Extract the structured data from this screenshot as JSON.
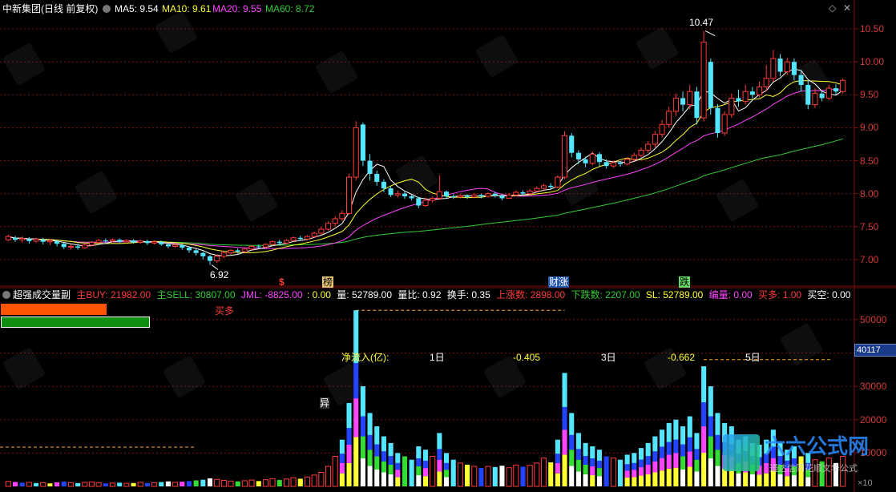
{
  "colors": {
    "bg": "#000000",
    "up": "#ff3b3b",
    "down": "#55e6ff",
    "grid": "#7a1010",
    "ma5": "#ffffff",
    "ma10": "#ffff33",
    "ma20": "#ff44ff",
    "ma60": "#33cc33",
    "green": "#00c000",
    "orange": "#ff5500"
  },
  "main_header": {
    "title": "中新集团(日线 前复权)",
    "ma5_label": "MA5: 9.54",
    "ma10_label": "MA10: 9.61",
    "ma20_label": "MA20: 9.55",
    "ma60_label": "MA60: 8.72",
    "collapse_icon": "diamond-icon",
    "close_icon": "close-icon"
  },
  "price_axis": {
    "ticks": [
      "10.50",
      "10.00",
      "9.50",
      "9.00",
      "8.50",
      "8.00",
      "7.50",
      "7.00"
    ],
    "ymin": 6.78,
    "ymax": 10.72
  },
  "annotations": {
    "high": "10.47",
    "low": "6.92",
    "event_s": "$",
    "event_1": "榜",
    "event_2": "财涨",
    "event_3": "跌"
  },
  "sub_header": {
    "title": "超强成交量副",
    "buy": "主BUY: 21982.00",
    "sell": "主SELL: 30807.00",
    "jml": "JML: -8825.00",
    "colon_val": ": 0.00",
    "vol": "量: 52789.00",
    "vol_ratio": "量比: 0.92",
    "turnover": "换手: 0.35",
    "up_count": "上涨数: 2898.00",
    "down_count": "下跌数: 2207.00",
    "sl": "SL: 52789.00",
    "bian_liang": "编量: 0.00",
    "buy_many": "买多: 1.00",
    "buy_empty": "买空: 0.00"
  },
  "sub_panel": {
    "mai_duo": "买多",
    "net_inflow_label": "净流入(亿):",
    "d1_label": "1日",
    "d1_value": "-0.405",
    "d3_label": "3日",
    "d3_value": "-0.662",
    "d5_label": "5日",
    "yi_label": "异",
    "cursor_value": "40117"
  },
  "volume_axis": {
    "ticks": [
      "50000",
      "40000",
      "30000",
      "20000",
      "10000"
    ],
    "vmax": 55000
  },
  "watermark": {
    "brand": "六六公式网",
    "subtitle": "通达信同花顺文华公式",
    "corner_text": "×10"
  },
  "chart_data": {
    "type": "candlestick",
    "series": [
      {
        "name": "MA5",
        "value": 9.54
      },
      {
        "name": "MA10",
        "value": 9.61
      },
      {
        "name": "MA20",
        "value": 9.55
      },
      {
        "name": "MA60",
        "value": 8.72
      }
    ],
    "high_label": 10.47,
    "low_label": 6.92,
    "candles": [
      [
        7.3,
        7.35,
        7.28,
        7.38
      ],
      [
        7.33,
        7.3,
        7.27,
        7.36
      ],
      [
        7.3,
        7.32,
        7.26,
        7.35
      ],
      [
        7.31,
        7.28,
        7.24,
        7.34
      ],
      [
        7.28,
        7.31,
        7.25,
        7.33
      ],
      [
        7.3,
        7.27,
        7.23,
        7.33
      ],
      [
        7.27,
        7.29,
        7.22,
        7.31
      ],
      [
        7.28,
        7.24,
        7.2,
        7.3
      ],
      [
        7.24,
        7.19,
        7.16,
        7.26
      ],
      [
        7.19,
        7.2,
        7.15,
        7.23
      ],
      [
        7.2,
        7.18,
        7.15,
        7.24
      ],
      [
        7.18,
        7.22,
        7.16,
        7.25
      ],
      [
        7.22,
        7.26,
        7.2,
        7.28
      ],
      [
        7.26,
        7.29,
        7.24,
        7.31
      ],
      [
        7.29,
        7.28,
        7.25,
        7.32
      ],
      [
        7.28,
        7.3,
        7.26,
        7.32
      ],
      [
        7.3,
        7.27,
        7.25,
        7.32
      ],
      [
        7.27,
        7.29,
        7.25,
        7.31
      ],
      [
        7.29,
        7.26,
        7.24,
        7.31
      ],
      [
        7.26,
        7.28,
        7.24,
        7.3
      ],
      [
        7.28,
        7.25,
        7.22,
        7.3
      ],
      [
        7.25,
        7.27,
        7.23,
        7.29
      ],
      [
        7.27,
        7.23,
        7.21,
        7.29
      ],
      [
        7.23,
        7.2,
        7.17,
        7.25
      ],
      [
        7.2,
        7.22,
        7.18,
        7.24
      ],
      [
        7.22,
        7.18,
        7.15,
        7.24
      ],
      [
        7.18,
        7.14,
        7.1,
        7.2
      ],
      [
        7.14,
        7.1,
        7.06,
        7.16
      ],
      [
        7.1,
        7.05,
        7.0,
        7.12
      ],
      [
        7.05,
        6.98,
        6.92,
        7.07
      ],
      [
        6.98,
        7.05,
        6.95,
        7.08
      ],
      [
        7.05,
        7.1,
        7.02,
        7.13
      ],
      [
        7.1,
        7.14,
        7.07,
        7.16
      ],
      [
        7.14,
        7.12,
        7.09,
        7.17
      ],
      [
        7.12,
        7.16,
        7.1,
        7.18
      ],
      [
        7.16,
        7.2,
        7.14,
        7.22
      ],
      [
        7.2,
        7.19,
        7.16,
        7.23
      ],
      [
        7.19,
        7.23,
        7.17,
        7.25
      ],
      [
        7.23,
        7.27,
        7.21,
        7.29
      ],
      [
        7.27,
        7.25,
        7.22,
        7.3
      ],
      [
        7.25,
        7.29,
        7.23,
        7.31
      ],
      [
        7.29,
        7.33,
        7.27,
        7.35
      ],
      [
        7.33,
        7.31,
        7.28,
        7.36
      ],
      [
        7.31,
        7.35,
        7.29,
        7.37
      ],
      [
        7.35,
        7.4,
        7.33,
        7.42
      ],
      [
        7.4,
        7.46,
        7.38,
        7.5
      ],
      [
        7.46,
        7.55,
        7.44,
        7.58
      ],
      [
        7.55,
        7.62,
        7.5,
        7.66
      ],
      [
        7.62,
        7.7,
        7.58,
        7.75
      ],
      [
        7.7,
        8.25,
        7.68,
        8.3
      ],
      [
        8.25,
        9.0,
        8.2,
        9.1
      ],
      [
        9.05,
        8.5,
        8.42,
        9.08
      ],
      [
        8.5,
        8.3,
        8.2,
        8.6
      ],
      [
        8.3,
        8.18,
        8.12,
        8.35
      ],
      [
        8.18,
        8.08,
        8.02,
        8.22
      ],
      [
        8.08,
        7.98,
        7.95,
        8.12
      ],
      [
        7.98,
        8.0,
        7.94,
        8.05
      ],
      [
        8.0,
        7.96,
        7.92,
        8.03
      ],
      [
        7.96,
        7.93,
        7.9,
        7.99
      ],
      [
        7.93,
        7.82,
        7.78,
        7.95
      ],
      [
        7.82,
        7.9,
        7.8,
        7.94
      ],
      [
        7.9,
        7.93,
        7.86,
        7.96
      ],
      [
        7.93,
        8.03,
        7.9,
        8.28
      ],
      [
        8.03,
        7.96,
        7.92,
        8.05
      ],
      [
        7.96,
        7.95,
        7.92,
        7.99
      ],
      [
        7.95,
        7.97,
        7.93,
        8.0
      ],
      [
        7.97,
        7.95,
        7.92,
        7.99
      ],
      [
        7.95,
        7.98,
        7.93,
        8.01
      ],
      [
        7.98,
        7.96,
        7.93,
        8.0
      ],
      [
        7.96,
        8.0,
        7.94,
        8.02
      ],
      [
        8.0,
        7.97,
        7.94,
        8.03
      ],
      [
        7.97,
        7.93,
        7.9,
        7.99
      ],
      [
        7.93,
        7.98,
        7.92,
        8.01
      ],
      [
        7.98,
        8.02,
        7.96,
        8.05
      ],
      [
        8.02,
        8.0,
        7.97,
        8.05
      ],
      [
        8.0,
        8.04,
        7.98,
        8.07
      ],
      [
        8.04,
        8.08,
        8.02,
        8.11
      ],
      [
        8.08,
        8.12,
        8.05,
        8.15
      ],
      [
        8.12,
        8.1,
        8.07,
        8.16
      ],
      [
        8.1,
        8.25,
        8.08,
        8.28
      ],
      [
        8.25,
        8.88,
        8.22,
        8.95
      ],
      [
        8.88,
        8.62,
        8.55,
        8.92
      ],
      [
        8.62,
        8.52,
        8.45,
        8.66
      ],
      [
        8.52,
        8.46,
        8.4,
        8.56
      ],
      [
        8.46,
        8.6,
        8.43,
        8.64
      ],
      [
        8.6,
        8.48,
        8.42,
        8.63
      ],
      [
        8.48,
        8.42,
        8.38,
        8.52
      ],
      [
        8.42,
        8.47,
        8.39,
        8.5
      ],
      [
        8.47,
        8.45,
        8.41,
        8.5
      ],
      [
        8.45,
        8.52,
        8.43,
        8.55
      ],
      [
        8.52,
        8.58,
        8.49,
        8.62
      ],
      [
        8.58,
        8.66,
        8.55,
        8.7
      ],
      [
        8.66,
        8.75,
        8.62,
        8.8
      ],
      [
        8.75,
        8.9,
        8.7,
        8.95
      ],
      [
        8.9,
        9.05,
        8.85,
        9.12
      ],
      [
        9.05,
        9.25,
        9.0,
        9.32
      ],
      [
        9.25,
        9.45,
        9.18,
        9.52
      ],
      [
        9.45,
        9.35,
        9.25,
        9.55
      ],
      [
        9.35,
        9.55,
        9.28,
        9.65
      ],
      [
        9.55,
        9.15,
        9.05,
        9.62
      ],
      [
        9.15,
        10.3,
        9.1,
        10.47
      ],
      [
        10.0,
        9.3,
        9.2,
        10.05
      ],
      [
        9.3,
        8.92,
        8.85,
        9.36
      ],
      [
        8.92,
        9.2,
        8.88,
        9.25
      ],
      [
        9.2,
        9.45,
        9.15,
        9.52
      ],
      [
        9.45,
        9.4,
        9.32,
        9.58
      ],
      [
        9.4,
        9.55,
        9.35,
        9.65
      ],
      [
        9.55,
        9.5,
        9.45,
        9.62
      ],
      [
        9.5,
        9.62,
        9.46,
        9.7
      ],
      [
        9.62,
        9.75,
        9.55,
        9.95
      ],
      [
        9.75,
        10.05,
        9.7,
        10.18
      ],
      [
        10.05,
        9.85,
        9.78,
        10.12
      ],
      [
        9.85,
        10.0,
        9.8,
        10.06
      ],
      [
        10.0,
        9.8,
        9.72,
        10.05
      ],
      [
        9.8,
        9.65,
        9.55,
        9.88
      ],
      [
        9.65,
        9.35,
        9.28,
        9.72
      ],
      [
        9.35,
        9.52,
        9.3,
        9.6
      ],
      [
        9.52,
        9.45,
        9.4,
        9.56
      ],
      [
        9.45,
        9.6,
        9.42,
        9.65
      ],
      [
        9.6,
        9.55,
        9.5,
        9.66
      ],
      [
        9.55,
        9.72,
        9.52,
        9.75
      ]
    ],
    "volumes": [
      [
        1500,
        1
      ],
      [
        1300,
        0
      ],
      [
        1100,
        0
      ],
      [
        1200,
        1
      ],
      [
        1000,
        0
      ],
      [
        1100,
        1
      ],
      [
        900,
        0
      ],
      [
        1200,
        0
      ],
      [
        1400,
        0
      ],
      [
        1100,
        1
      ],
      [
        1000,
        0
      ],
      [
        1200,
        1
      ],
      [
        1300,
        1
      ],
      [
        1100,
        1
      ],
      [
        900,
        0
      ],
      [
        1000,
        1
      ],
      [
        1100,
        0
      ],
      [
        900,
        1
      ],
      [
        1000,
        0
      ],
      [
        1200,
        1
      ],
      [
        1000,
        0
      ],
      [
        1100,
        1
      ],
      [
        1300,
        0
      ],
      [
        1500,
        0
      ],
      [
        1200,
        1
      ],
      [
        1400,
        0
      ],
      [
        1600,
        0
      ],
      [
        1800,
        0
      ],
      [
        2000,
        0
      ],
      [
        2400,
        0
      ],
      [
        2100,
        1
      ],
      [
        1800,
        1
      ],
      [
        1600,
        1
      ],
      [
        1500,
        0
      ],
      [
        1700,
        1
      ],
      [
        1900,
        1
      ],
      [
        1600,
        0
      ],
      [
        2000,
        1
      ],
      [
        2300,
        1
      ],
      [
        1900,
        0
      ],
      [
        2200,
        1
      ],
      [
        2600,
        1
      ],
      [
        2300,
        0
      ],
      [
        2800,
        1
      ],
      [
        3400,
        1
      ],
      [
        4200,
        1
      ],
      [
        6000,
        1
      ],
      [
        9000,
        1
      ],
      [
        14000,
        1
      ],
      [
        25000,
        1
      ],
      [
        52789,
        1
      ],
      [
        30000,
        0
      ],
      [
        22000,
        0
      ],
      [
        18000,
        0
      ],
      [
        15000,
        0
      ],
      [
        13000,
        0
      ],
      [
        10000,
        1
      ],
      [
        9000,
        0
      ],
      [
        8000,
        0
      ],
      [
        12000,
        0
      ],
      [
        11000,
        1
      ],
      [
        9000,
        1
      ],
      [
        16000,
        1
      ],
      [
        10000,
        0
      ],
      [
        8000,
        0
      ],
      [
        7000,
        1
      ],
      [
        6500,
        0
      ],
      [
        6000,
        1
      ],
      [
        5500,
        0
      ],
      [
        6000,
        1
      ],
      [
        5800,
        0
      ],
      [
        6200,
        0
      ],
      [
        5600,
        1
      ],
      [
        6400,
        1
      ],
      [
        5900,
        0
      ],
      [
        6300,
        1
      ],
      [
        7000,
        1
      ],
      [
        8500,
        1
      ],
      [
        7200,
        0
      ],
      [
        14000,
        1
      ],
      [
        34000,
        1
      ],
      [
        22000,
        0
      ],
      [
        16000,
        0
      ],
      [
        13000,
        0
      ],
      [
        12000,
        1
      ],
      [
        11000,
        0
      ],
      [
        9000,
        0
      ],
      [
        8500,
        1
      ],
      [
        8000,
        0
      ],
      [
        9500,
        1
      ],
      [
        10000,
        1
      ],
      [
        11500,
        1
      ],
      [
        13000,
        1
      ],
      [
        15000,
        1
      ],
      [
        17000,
        1
      ],
      [
        19000,
        1
      ],
      [
        20000,
        1
      ],
      [
        18000,
        0
      ],
      [
        21000,
        1
      ],
      [
        16000,
        0
      ],
      [
        36000,
        1
      ],
      [
        30000,
        0
      ],
      [
        22000,
        0
      ],
      [
        19000,
        1
      ],
      [
        18000,
        1
      ],
      [
        14000,
        0
      ],
      [
        15000,
        1
      ],
      [
        13000,
        0
      ],
      [
        12500,
        1
      ],
      [
        14000,
        1
      ],
      [
        17000,
        1
      ],
      [
        13000,
        0
      ],
      [
        11000,
        1
      ],
      [
        12000,
        0
      ],
      [
        9000,
        0
      ],
      [
        10000,
        0
      ],
      [
        8000,
        1
      ],
      [
        7500,
        0
      ],
      [
        8500,
        1
      ],
      [
        7000,
        0
      ],
      [
        9000,
        1
      ]
    ]
  }
}
